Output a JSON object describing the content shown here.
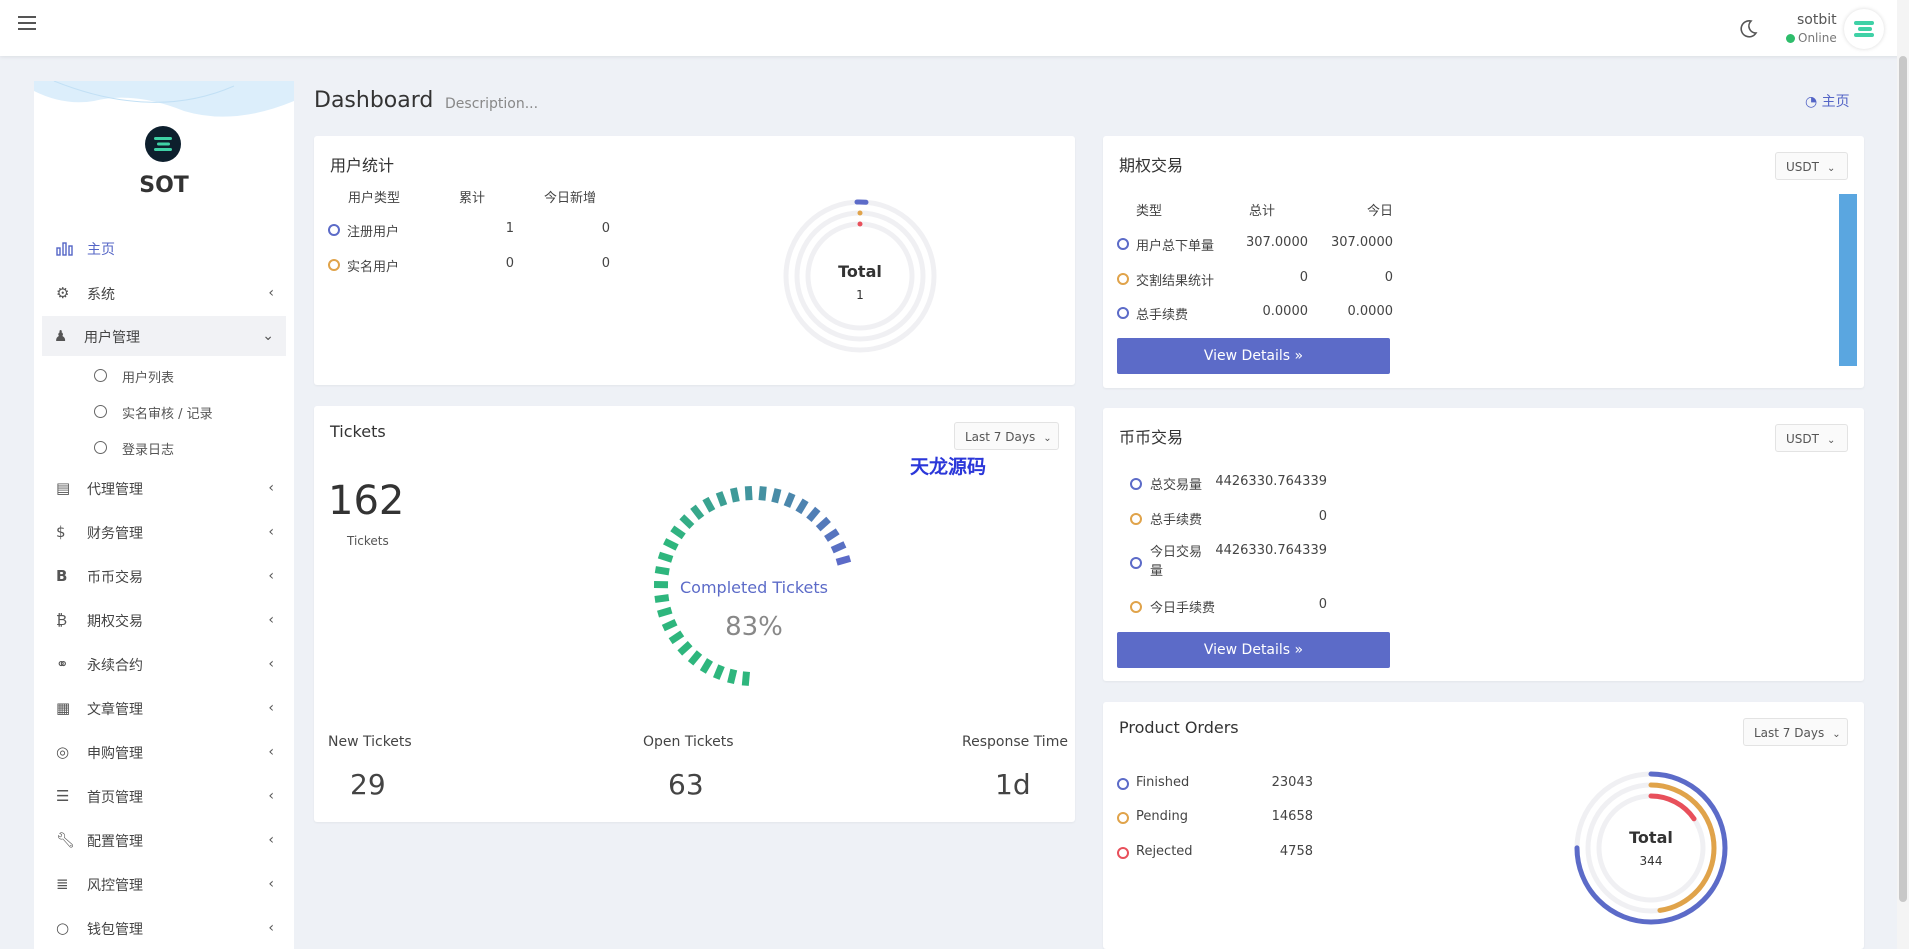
{
  "topbar": {
    "user_name": "sotbit",
    "user_status": "Online"
  },
  "sidebar": {
    "logo_text": "SOT",
    "items": [
      {
        "label": "主页",
        "icon": "bar-chart-icon"
      },
      {
        "label": "系统",
        "icon": "gear-icon"
      },
      {
        "label": "用户管理",
        "icon": "user-icon"
      },
      {
        "label": "代理管理",
        "icon": "id-card-icon"
      },
      {
        "label": "财务管理",
        "icon": "dollar-icon"
      },
      {
        "label": "币币交易",
        "icon": "bold-b-icon"
      },
      {
        "label": "期权交易",
        "icon": "bitcoin-icon"
      },
      {
        "label": "永续合约",
        "icon": "link-icon"
      },
      {
        "label": "文章管理",
        "icon": "newspaper-icon"
      },
      {
        "label": "申购管理",
        "icon": "lifebuoy-icon"
      },
      {
        "label": "首页管理",
        "icon": "list-icon"
      },
      {
        "label": "配置管理",
        "icon": "wrench-icon"
      },
      {
        "label": "风控管理",
        "icon": "indent-icon"
      },
      {
        "label": "钱包管理",
        "icon": "circle-icon"
      }
    ],
    "sub_items": [
      "用户列表",
      "实名审核 / 记录",
      "登录日志"
    ]
  },
  "header": {
    "title": "Dashboard",
    "description": "Description...",
    "breadcrumb": "主页"
  },
  "user_stats": {
    "title": "用户统计",
    "headers": [
      "用户类型",
      "累计",
      "今日新增"
    ],
    "rows": [
      {
        "type": "注册用户",
        "total": "1",
        "today": "0"
      },
      {
        "type": "实名用户",
        "total": "0",
        "today": "0"
      }
    ],
    "donut_label": "Total",
    "donut_value": "1"
  },
  "options_trading": {
    "title": "期权交易",
    "currency": "USDT",
    "headers": [
      "类型",
      "总计",
      "今日"
    ],
    "rows": [
      {
        "type": "用户总下单量",
        "total": "307.0000",
        "today": "307.0000"
      },
      {
        "type": "交割结果统计",
        "total": "0",
        "today": "0"
      },
      {
        "type": "总手续费",
        "total": "0.0000",
        "today": "0.0000"
      }
    ],
    "button": "View Details"
  },
  "tickets": {
    "title": "Tickets",
    "range": "Last 7 Days",
    "count": "162",
    "count_label": "Tickets",
    "gauge_label": "Completed Tickets",
    "gauge_value": "83%",
    "gauge_fraction": 0.83,
    "stats": [
      {
        "label": "New Tickets",
        "value": "29"
      },
      {
        "label": "Open Tickets",
        "value": "63"
      },
      {
        "label": "Response Time",
        "value": "1d"
      }
    ],
    "watermark": "天龙源码"
  },
  "spot_trading": {
    "title": "币币交易",
    "currency": "USDT",
    "rows": [
      {
        "label": "总交易量",
        "value": "4426330.764339"
      },
      {
        "label": "总手续费",
        "value": "0"
      },
      {
        "label": "今日交易量",
        "value": "4426330.764339"
      },
      {
        "label": "今日手续费",
        "value": "0"
      }
    ],
    "button": "View Details"
  },
  "product_orders": {
    "title": "Product Orders",
    "range": "Last 7 Days",
    "legend": [
      {
        "label": "Finished",
        "value": "23043"
      },
      {
        "label": "Pending",
        "value": "14658"
      },
      {
        "label": "Rejected",
        "value": "4758"
      }
    ],
    "donut_label": "Total",
    "donut_value": "344"
  },
  "colors": {
    "primary": "#5c6bc8",
    "orange": "#e0a34a",
    "red": "#e8505b",
    "green": "#2eb67d",
    "bar_blue": "#5aa6e0"
  }
}
